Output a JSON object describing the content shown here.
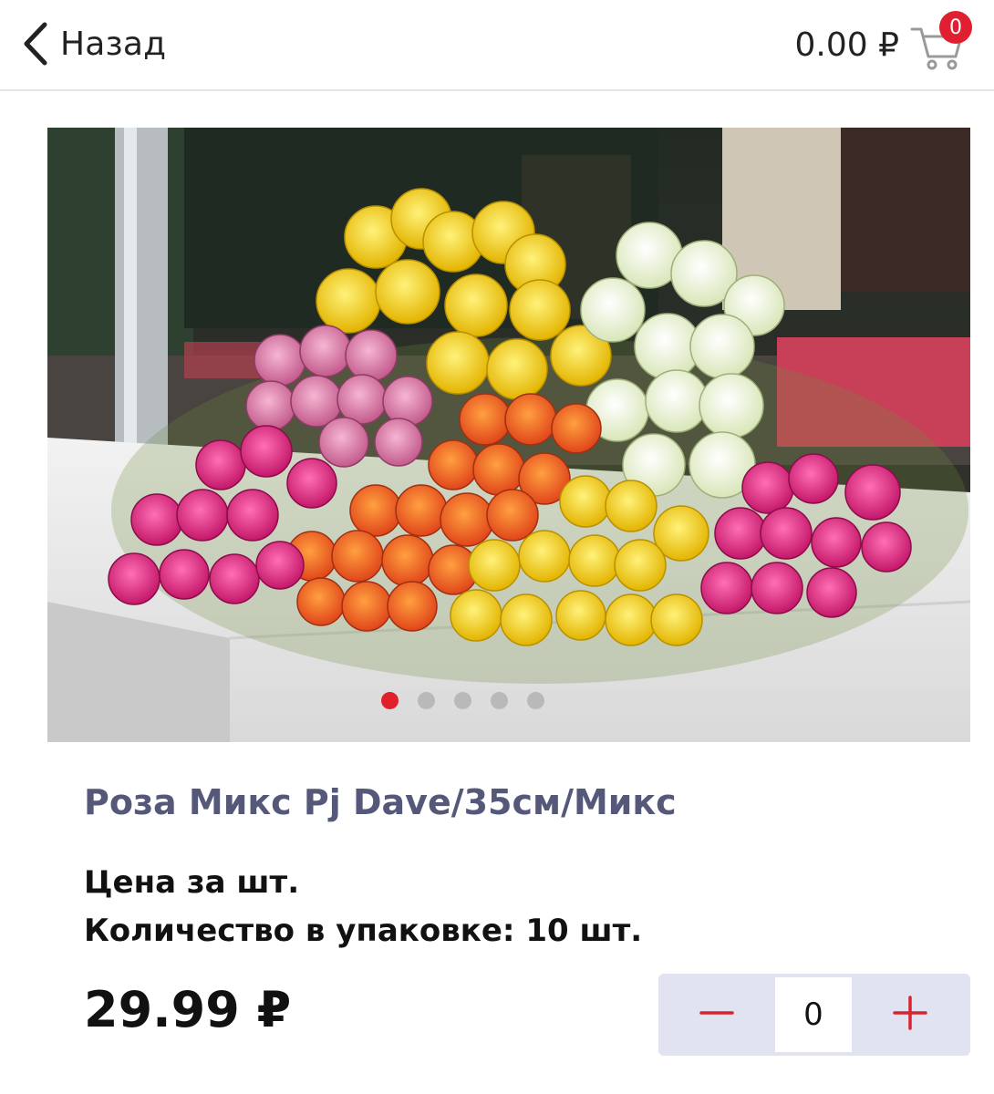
{
  "header": {
    "back_label": "Назад",
    "cart_total": "0.00 ₽",
    "cart_count": "0"
  },
  "gallery": {
    "slide_count": 5,
    "active_slide": 1,
    "image_icon": "flower-bouquet-photo"
  },
  "product": {
    "title": "Роза Микс Pj Dave/35см/Микс",
    "price_note": "Цена за шт.",
    "pack_info": "Количество в упаковке: 10 шт.",
    "price": "29.99 ₽"
  },
  "stepper": {
    "value": "0",
    "minus_icon": "minus-icon",
    "plus_icon": "plus-icon"
  },
  "colors": {
    "accent": "#e0212c",
    "title": "#56587a",
    "stepper_bg": "#e2e3f0",
    "dot_inactive": "#b9b9b9"
  }
}
